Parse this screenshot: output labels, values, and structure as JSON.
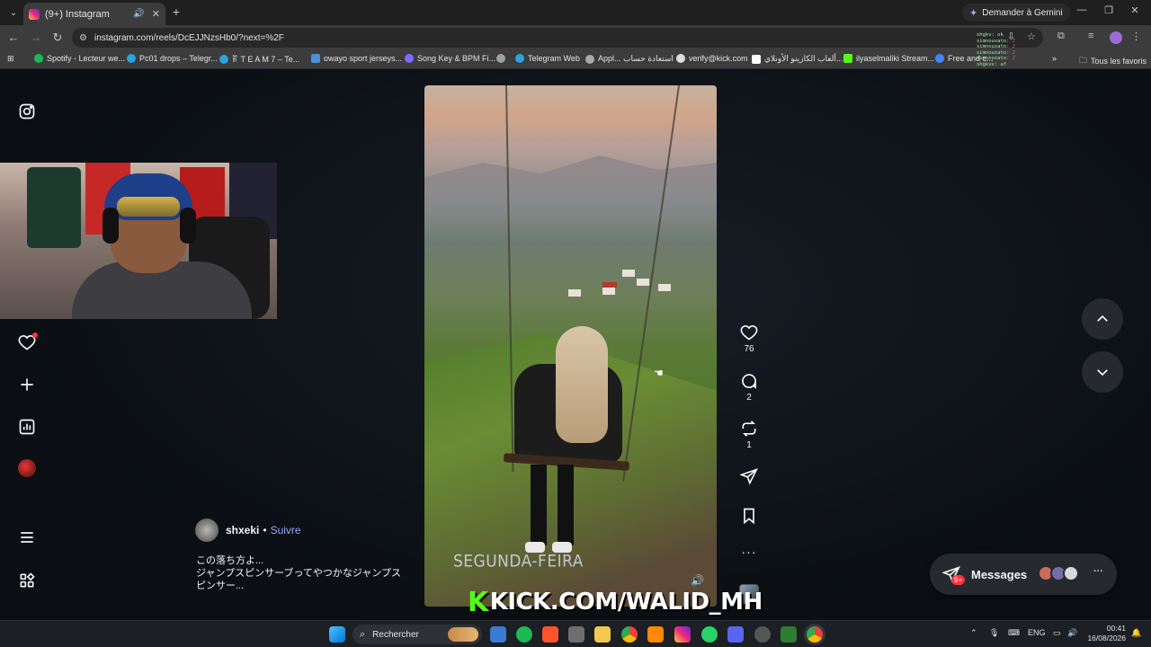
{
  "browser": {
    "tab_title": "(9+) Instagram",
    "new_tab": "+",
    "gemini_label": "Demander à Gemini",
    "url": "instagram.com/reels/DcEJJNzsHb0/?next=%2F",
    "bookmarks": [
      "Spotify - Lecteur we...",
      "Pc01 drops – Telegr...",
      "ꂵ T E A M 7 – Te...",
      "owayo sport jerseys...",
      "Song Key & BPM Fi...",
      "Telegram Web",
      "Appl... استعادة حساب",
      "verify@kick.com",
      "ألعاب الكازينو الأونلاي...",
      "ilyaselmaliki Stream...",
      "Free and c..."
    ],
    "bookmarks_more": "»",
    "all_bookmarks": "Tous les favoris",
    "chat_lines": [
      {
        "user": "shgkv",
        "msg": ": ok"
      },
      {
        "user": "simnouxato",
        "msg": ": ♪"
      },
      {
        "user": "simnouxato",
        "msg": ": ♪"
      },
      {
        "user": "simnouxato",
        "msg": ": ♪"
      },
      {
        "user": "simnouxato",
        "msg": ": ♪"
      },
      {
        "user": "shgkvv",
        "msg": ": af"
      }
    ]
  },
  "sidebar": {
    "icons": [
      "instagram-icon",
      "heart-icon",
      "create-icon",
      "dashboard-icon",
      "profile-avatar",
      "menu-icon",
      "apps-icon"
    ]
  },
  "reel": {
    "overlay_text": "SEGUNDA-FEIRA",
    "volume_icon": "🔊",
    "likes": "76",
    "comments": "2",
    "reposts": "1",
    "more": "···"
  },
  "author": {
    "username": "shxeki",
    "separator": "•",
    "follow_label": "Suivre",
    "caption_line1": "この落ち方よ...",
    "caption_line2": "ジャンプスピンサーブってやつかなジャンプスピンサー..."
  },
  "stream_overlay": {
    "kick_logo": "K",
    "kick_text": "KICK.COM/WALID_MH"
  },
  "messages": {
    "label": "Messages",
    "badge": "9+",
    "more": "···"
  },
  "taskbar": {
    "search_label": "Rechercher",
    "language": "ENG",
    "time": "00:41",
    "date": "16/08/2026"
  },
  "colors": {
    "instagram_bg": "#0b0f14",
    "follow_blue": "#8fa7ff",
    "notif_red": "#ff3040",
    "kick_green": "#53fc18"
  }
}
